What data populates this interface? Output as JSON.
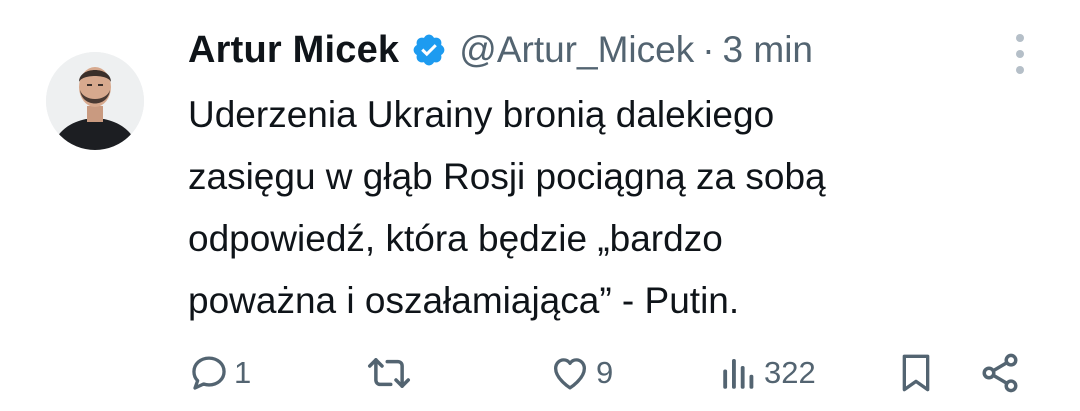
{
  "author": {
    "display_name": "Artur Micek",
    "handle": "@Artur_Micek",
    "separator": "·",
    "time": "3 min"
  },
  "tweet": {
    "lines": [
      "Uderzenia Ukrainy bronią dalekiego",
      "zasięgu w głąb Rosji pociągną za sobą",
      "odpowiedź, która będzie „bardzo",
      "poważna i oszałamiająca” - Putin."
    ]
  },
  "actions": {
    "replies": "1",
    "retweets": "",
    "likes": "9",
    "views": "322"
  },
  "colors": {
    "text": "#0f1419",
    "secondary": "#536471",
    "verified": "#1d9bf0"
  },
  "icons": [
    "verified-badge-icon",
    "more-icon",
    "reply-icon",
    "retweet-icon",
    "like-icon",
    "views-icon",
    "bookmark-icon",
    "share-icon"
  ]
}
